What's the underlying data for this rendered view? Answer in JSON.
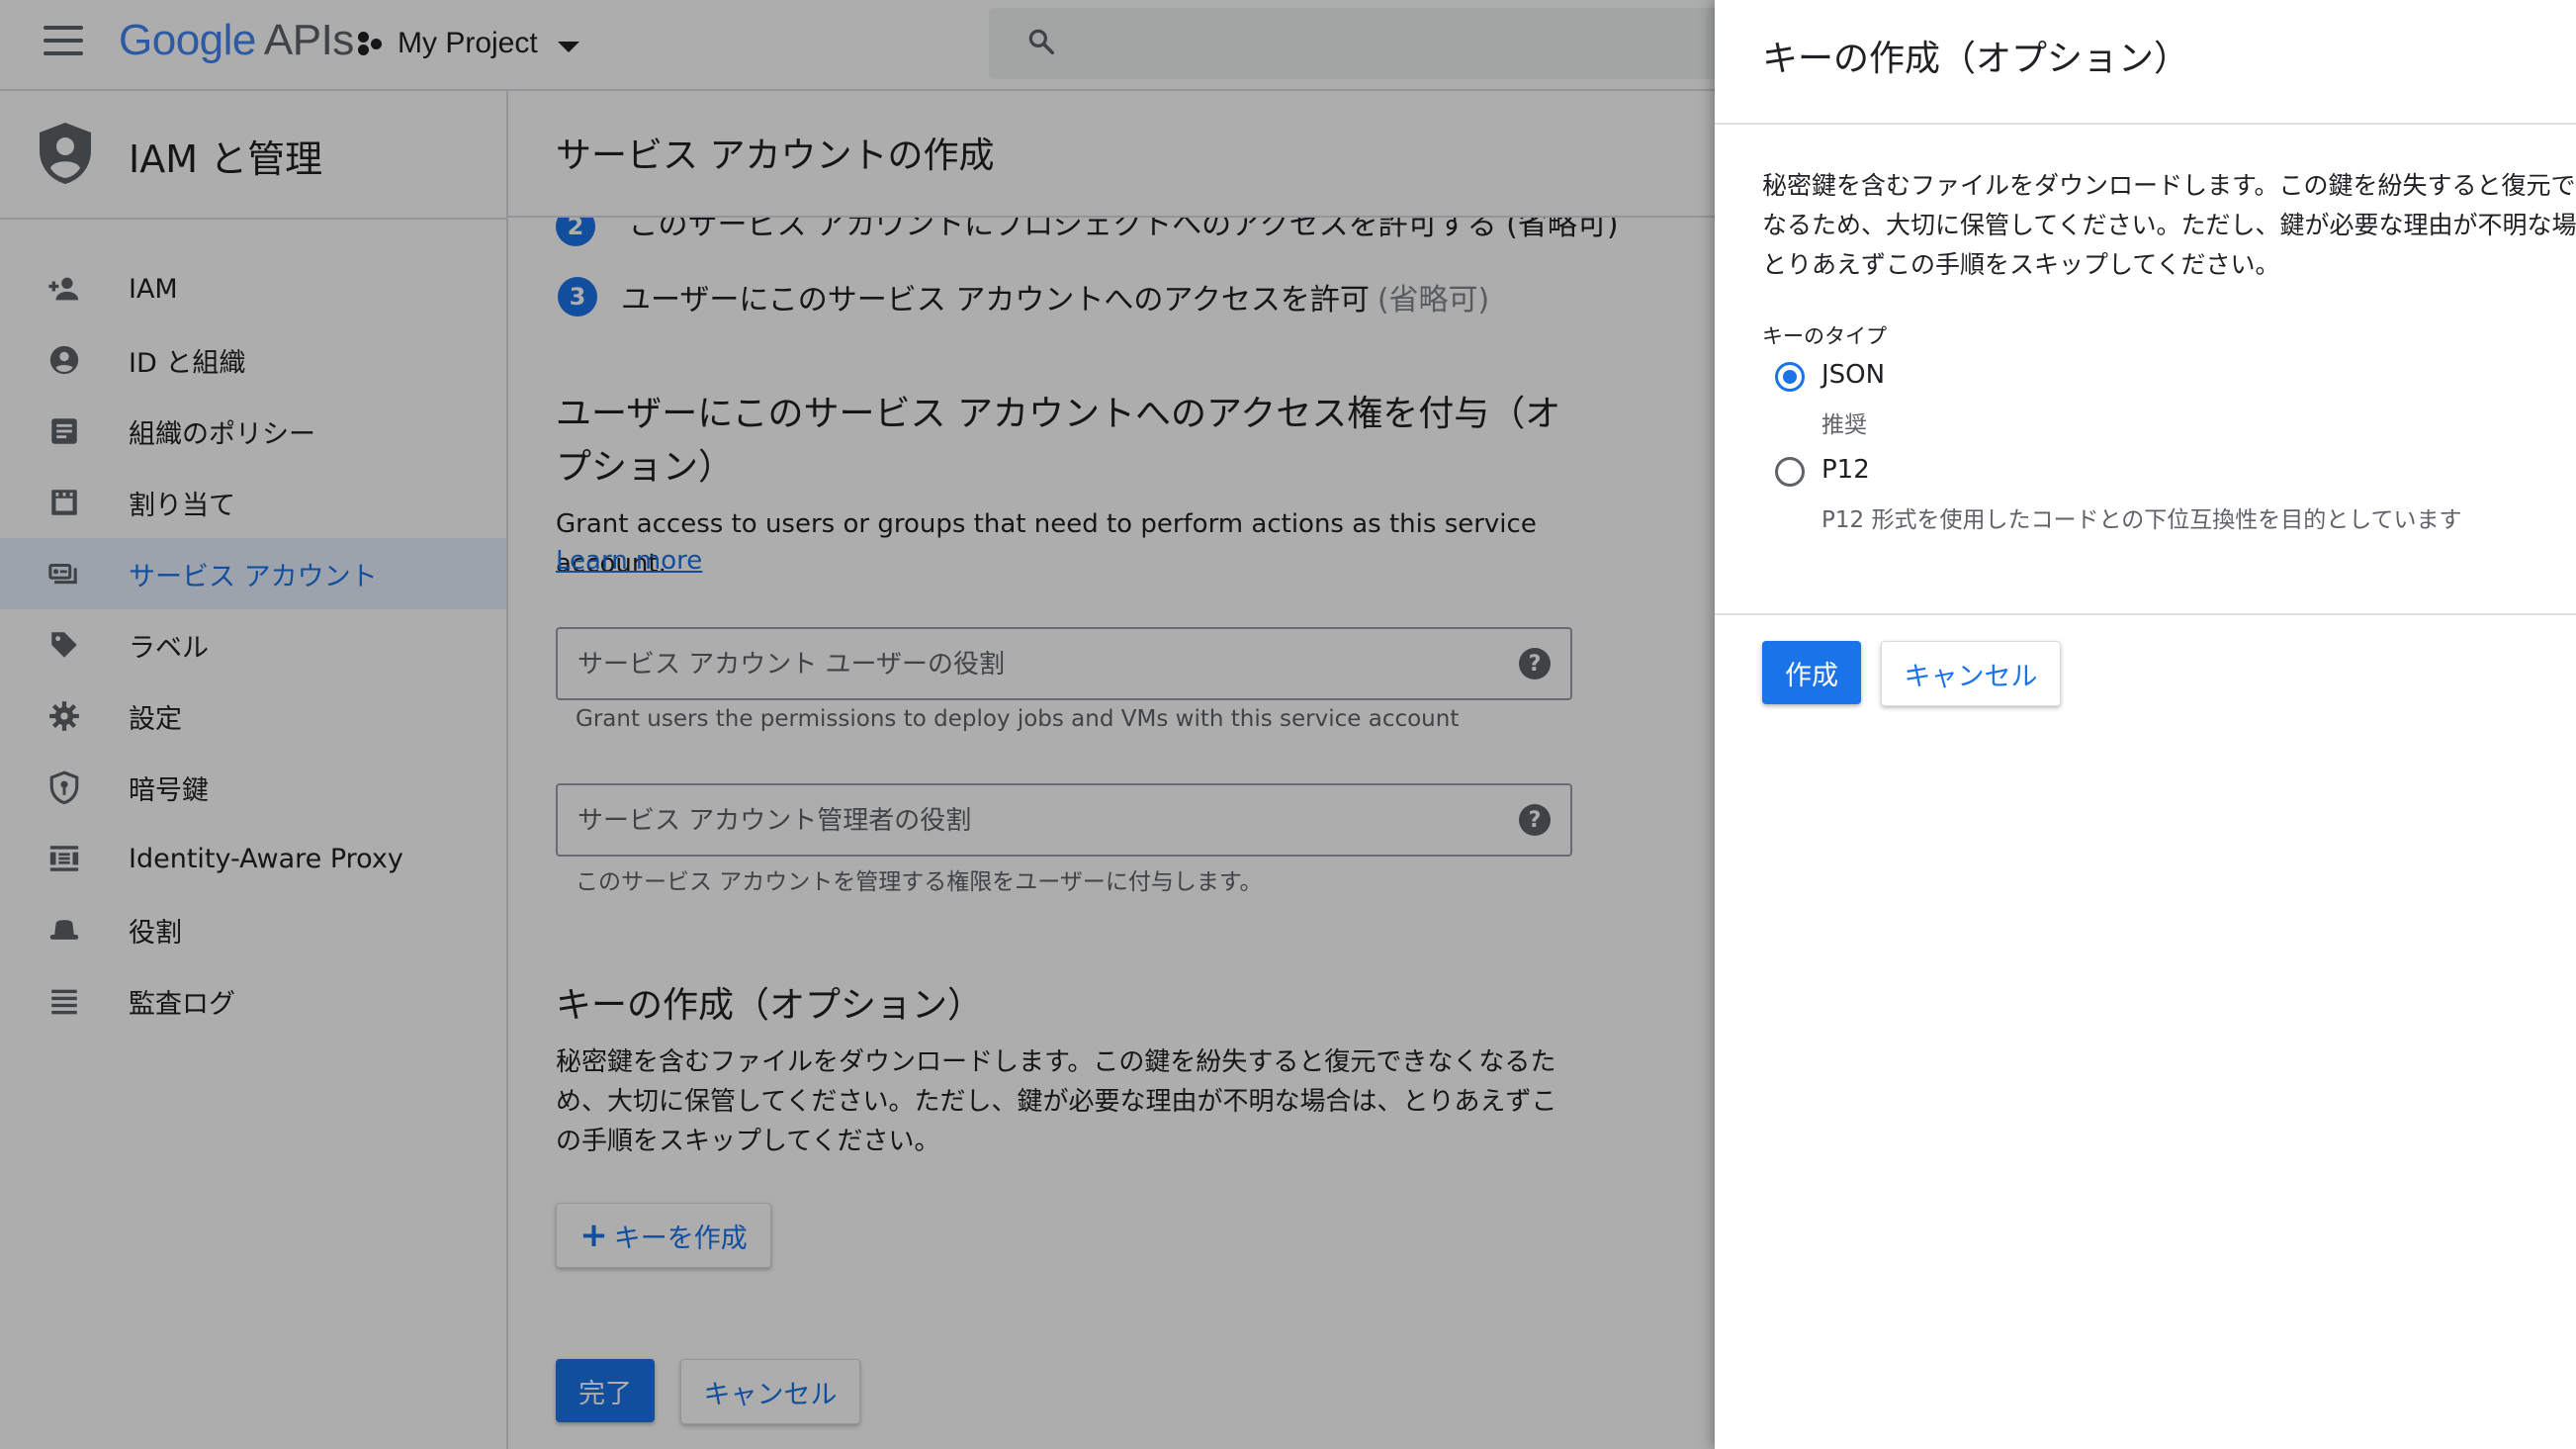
{
  "topbar": {
    "logo_google": "Google",
    "logo_apis": "APIs",
    "project_name": "My Project"
  },
  "sidebar": {
    "title": "IAM と管理",
    "items": [
      {
        "label": "IAM",
        "icon": "person-add-icon"
      },
      {
        "label": "ID と組織",
        "icon": "account-circle-icon"
      },
      {
        "label": "組織のポリシー",
        "icon": "policy-document-icon"
      },
      {
        "label": "割り当て",
        "icon": "quotas-icon"
      },
      {
        "label": "サービス アカウント",
        "icon": "service-account-icon",
        "active": true
      },
      {
        "label": "ラベル",
        "icon": "label-tag-icon"
      },
      {
        "label": "設定",
        "icon": "gear-icon"
      },
      {
        "label": "暗号鍵",
        "icon": "shield-key-icon"
      },
      {
        "label": "Identity-Aware Proxy",
        "icon": "proxy-icon"
      },
      {
        "label": "役割",
        "icon": "roles-hat-icon"
      },
      {
        "label": "監査ログ",
        "icon": "audit-log-icon"
      }
    ]
  },
  "main": {
    "title": "サービス アカウントの作成",
    "step2_text": "このサービス アカウントにプロジェクトへのアクセスを許可する (省略可)",
    "step3_number": "3",
    "step3_text": "ユーザーにこのサービス アカウントへのアクセスを許可",
    "step3_optional": "(省略可)",
    "grant_section_title": "ユーザーにこのサービス アカウントへのアクセス権を付与（オプション）",
    "grant_description": "Grant access to users or groups that need to perform actions as this service account.",
    "learn_more": "Learn more",
    "user_role_placeholder": "サービス アカウント ユーザーの役割",
    "user_role_hint": "Grant users the permissions to deploy jobs and VMs with this service account",
    "admin_role_placeholder": "サービス アカウント管理者の役割",
    "admin_role_hint": "このサービス アカウントを管理する権限をユーザーに付与します。",
    "key_section_title": "キーの作成（オプション）",
    "key_description": "秘密鍵を含むファイルをダウンロードします。この鍵を紛失すると復元できなくなるため、大切に保管してください。ただし、鍵が必要な理由が不明な場合は、とりあえずこの手順をスキップしてください。",
    "create_key_button": "キーを作成",
    "done_button": "完了",
    "cancel_button": "キャンセル"
  },
  "panel": {
    "title": "キーの作成（オプション）",
    "description": "秘密鍵を含むファイルをダウンロードします。この鍵を紛失すると復元できなくなるため、大切に保管してください。ただし、鍵が必要な理由が不明な場合は、とりあえずこの手順をスキップしてください。",
    "key_type_label": "キーのタイプ",
    "options": [
      {
        "label": "JSON",
        "sublabel": "推奨",
        "checked": true
      },
      {
        "label": "P12",
        "sublabel": "P12 形式を使用したコードとの下位互換性を目的としています",
        "checked": false
      }
    ],
    "create_button": "作成",
    "cancel_button": "キャンセル"
  },
  "colors": {
    "accent": "#1a73e8",
    "active_bg": "#e8f0fe",
    "scrim": "rgba(0,0,0,0.32)"
  }
}
